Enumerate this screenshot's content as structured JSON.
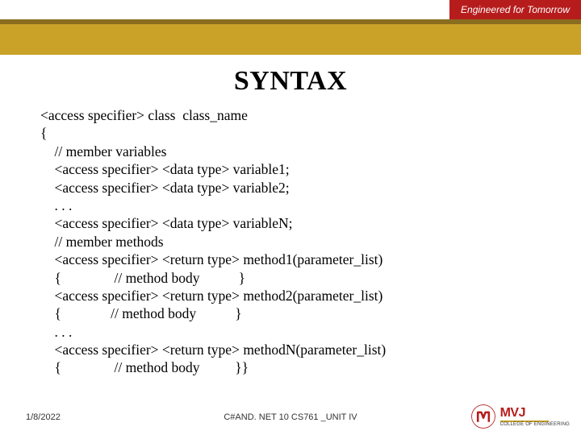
{
  "banner": {
    "tagline": "Engineered for Tomorrow"
  },
  "title": "SYNTAX",
  "code": "<access specifier> class  class_name\n{\n    // member variables\n    <access specifier> <data type> variable1;\n    <access specifier> <data type> variable2;\n    . . .\n    <access specifier> <data type> variableN;\n    // member methods\n    <access specifier> <return type> method1(parameter_list)\n    {               // method body           }\n    <access specifier> <return type> method2(parameter_list)\n    {              // method body           }\n    . . .\n    <access specifier> <return type> methodN(parameter_list)\n    {               // method body          }}",
  "footer": {
    "date": "1/8/2022",
    "label": "C#AND. NET 10 CS761 _UNIT IV"
  },
  "logo": {
    "main": "MVJ",
    "sub": "COLLEGE OF\nENGINEERING"
  }
}
